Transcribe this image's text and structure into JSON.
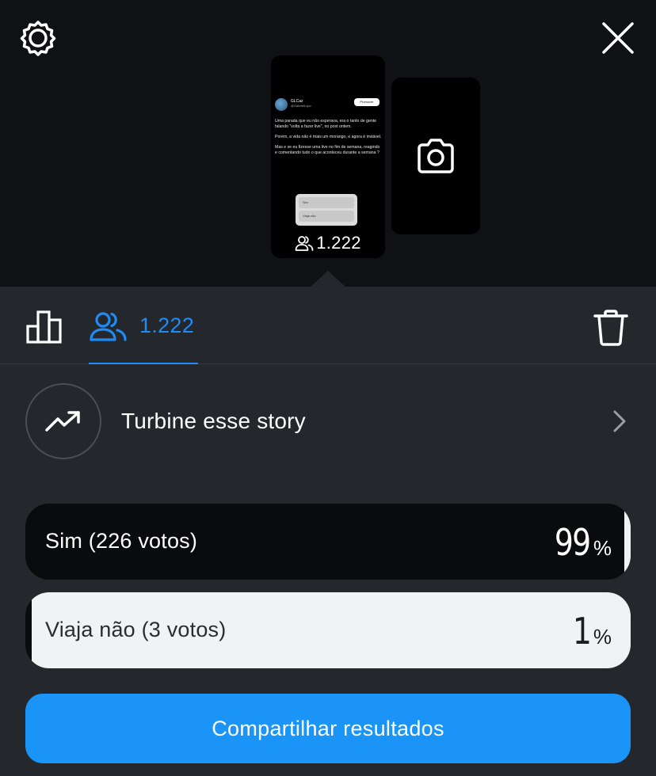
{
  "preview": {
    "author_name": "GLCaz",
    "author_handle": "@GabrielLopc",
    "promote_label": "Promover",
    "story_text": [
      "Uma parada que eu não esperava, era o tanto de gente falando \"volta a fazer live\", no post ontem.",
      "Porém, a vida não é mais um morango, e agora é inviável.",
      "Mas e se eu fizesse uma live no fim de semana, reagindo e comentando tudo o que aconteceu durante a semana ?"
    ],
    "poll_options": [
      "Sim",
      "Viaja não"
    ],
    "viewers": "1.222"
  },
  "tabs": {
    "viewers_count": "1.222"
  },
  "boost": {
    "label": "Turbine esse story"
  },
  "poll": {
    "options": [
      {
        "label": "Sim (226 votos)",
        "percent": "99",
        "fraction": 0.99
      },
      {
        "label": "Viaja não (3 votos)",
        "percent": "1",
        "fraction": 0.01
      }
    ],
    "percent_sign": "%"
  },
  "share_button": "Compartilhar resultados",
  "colors": {
    "accent": "#1f8cf5",
    "button": "#1a95f7",
    "sheet_bg": "#24272c",
    "top_bg": "#0f1115"
  },
  "icons": [
    "gear-icon",
    "close-icon",
    "camera-icon",
    "viewers-icon",
    "bar-chart-icon",
    "trash-icon",
    "trending-up-icon",
    "chevron-right-icon"
  ]
}
